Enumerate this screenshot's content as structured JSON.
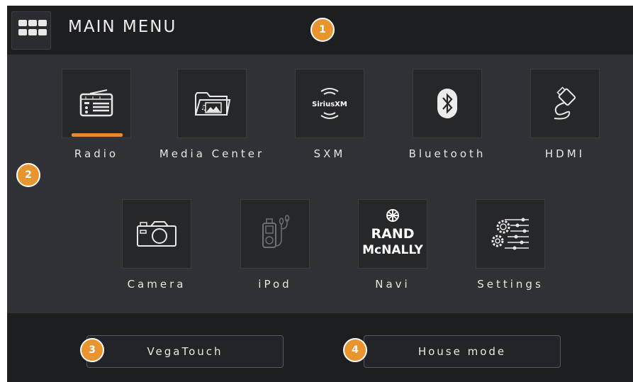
{
  "header": {
    "title": "MAIN MENU",
    "menu_icon": "grid-menu-icon"
  },
  "apps_row1": [
    {
      "label": "Radio",
      "icon": "radio-icon",
      "active": true
    },
    {
      "label": "Media Center",
      "icon": "media-folder-icon"
    },
    {
      "label": "SXM",
      "icon": "siriusxm-icon",
      "icon_text": "SiriusXM"
    },
    {
      "label": "Bluetooth",
      "icon": "bluetooth-icon"
    },
    {
      "label": "HDMI",
      "icon": "hdmi-cable-icon"
    }
  ],
  "apps_row2": [
    {
      "label": "Camera",
      "icon": "camera-icon"
    },
    {
      "label": "iPod",
      "icon": "ipod-icon",
      "disabled": true
    },
    {
      "label": "Navi",
      "icon": "rand-mcnally-logo",
      "logo_line1": "RAND",
      "logo_line2": "McNALLY"
    },
    {
      "label": "Settings",
      "icon": "settings-gears-icon"
    }
  ],
  "footer": {
    "vegatouch_label": "VegaTouch",
    "house_mode_label": "House mode"
  },
  "badges": [
    "1",
    "2",
    "3",
    "4"
  ],
  "colors": {
    "accent": "#e58a2e",
    "badge": "#e8952f",
    "background": "#2f3134",
    "bar": "#1d1e20"
  }
}
